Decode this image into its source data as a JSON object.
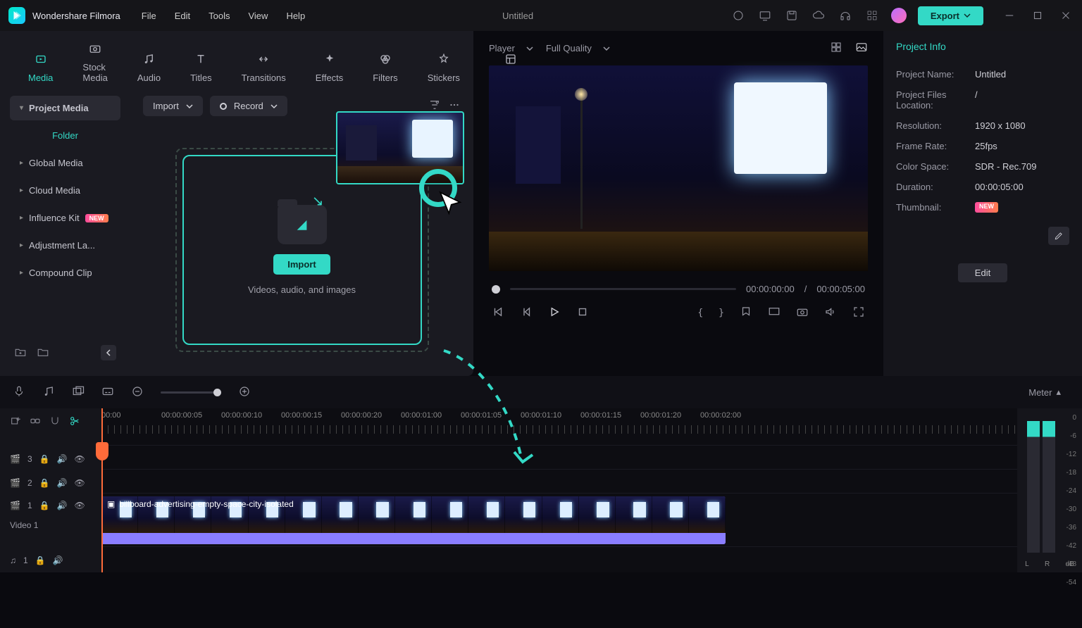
{
  "app": {
    "name": "Wondershare Filmora",
    "document": "Untitled"
  },
  "menu": [
    "File",
    "Edit",
    "Tools",
    "View",
    "Help"
  ],
  "export_label": "Export",
  "tabs": [
    {
      "label": "Media",
      "active": true
    },
    {
      "label": "Stock Media"
    },
    {
      "label": "Audio"
    },
    {
      "label": "Titles"
    },
    {
      "label": "Transitions"
    },
    {
      "label": "Effects"
    },
    {
      "label": "Filters"
    },
    {
      "label": "Stickers"
    },
    {
      "label": "Templates"
    }
  ],
  "sidebar": {
    "project_media": "Project Media",
    "folder": "Folder",
    "items": [
      {
        "label": "Global Media"
      },
      {
        "label": "Cloud Media"
      },
      {
        "label": "Influence Kit",
        "new": true
      },
      {
        "label": "Adjustment La..."
      },
      {
        "label": "Compound Clip"
      }
    ]
  },
  "media_toolbar": {
    "import": "Import",
    "record": "Record"
  },
  "drop": {
    "import": "Import",
    "sub": "Videos, audio, and images"
  },
  "preview": {
    "player": "Player",
    "quality": "Full Quality",
    "current": "00:00:00:00",
    "sep": "/",
    "total": "00:00:05:00"
  },
  "info": {
    "title": "Project Info",
    "rows": [
      {
        "k": "Project Name:",
        "v": "Untitled"
      },
      {
        "k": "Project Files Location:",
        "v": "/"
      },
      {
        "k": "Resolution:",
        "v": "1920 x 1080"
      },
      {
        "k": "Frame Rate:",
        "v": "25fps"
      },
      {
        "k": "Color Space:",
        "v": "SDR - Rec.709"
      },
      {
        "k": "Duration:",
        "v": "00:00:05:00"
      }
    ],
    "thumbnail": "Thumbnail:",
    "edit": "Edit"
  },
  "toolrow": {
    "meter": "Meter"
  },
  "ruler_ticks": [
    "00:00",
    "00:00:00:05",
    "00:00:00:10",
    "00:00:00:15",
    "00:00:00:20",
    "00:00:01:00",
    "00:00:01:05",
    "00:00:01:10",
    "00:00:01:15",
    "00:00:01:20",
    "00:00:02:00"
  ],
  "tracks": {
    "v3": "3",
    "v2": "2",
    "v1": "1",
    "v1label": "Video 1",
    "a1": "1"
  },
  "clip": {
    "label": "billboard-advertising-empty-space-city-isolated"
  },
  "meter": {
    "db": [
      "0",
      "-6",
      "-12",
      "-18",
      "-24",
      "-30",
      "-36",
      "-42",
      "-48",
      "-54"
    ],
    "unit": "dB",
    "L": "L",
    "R": "R"
  }
}
